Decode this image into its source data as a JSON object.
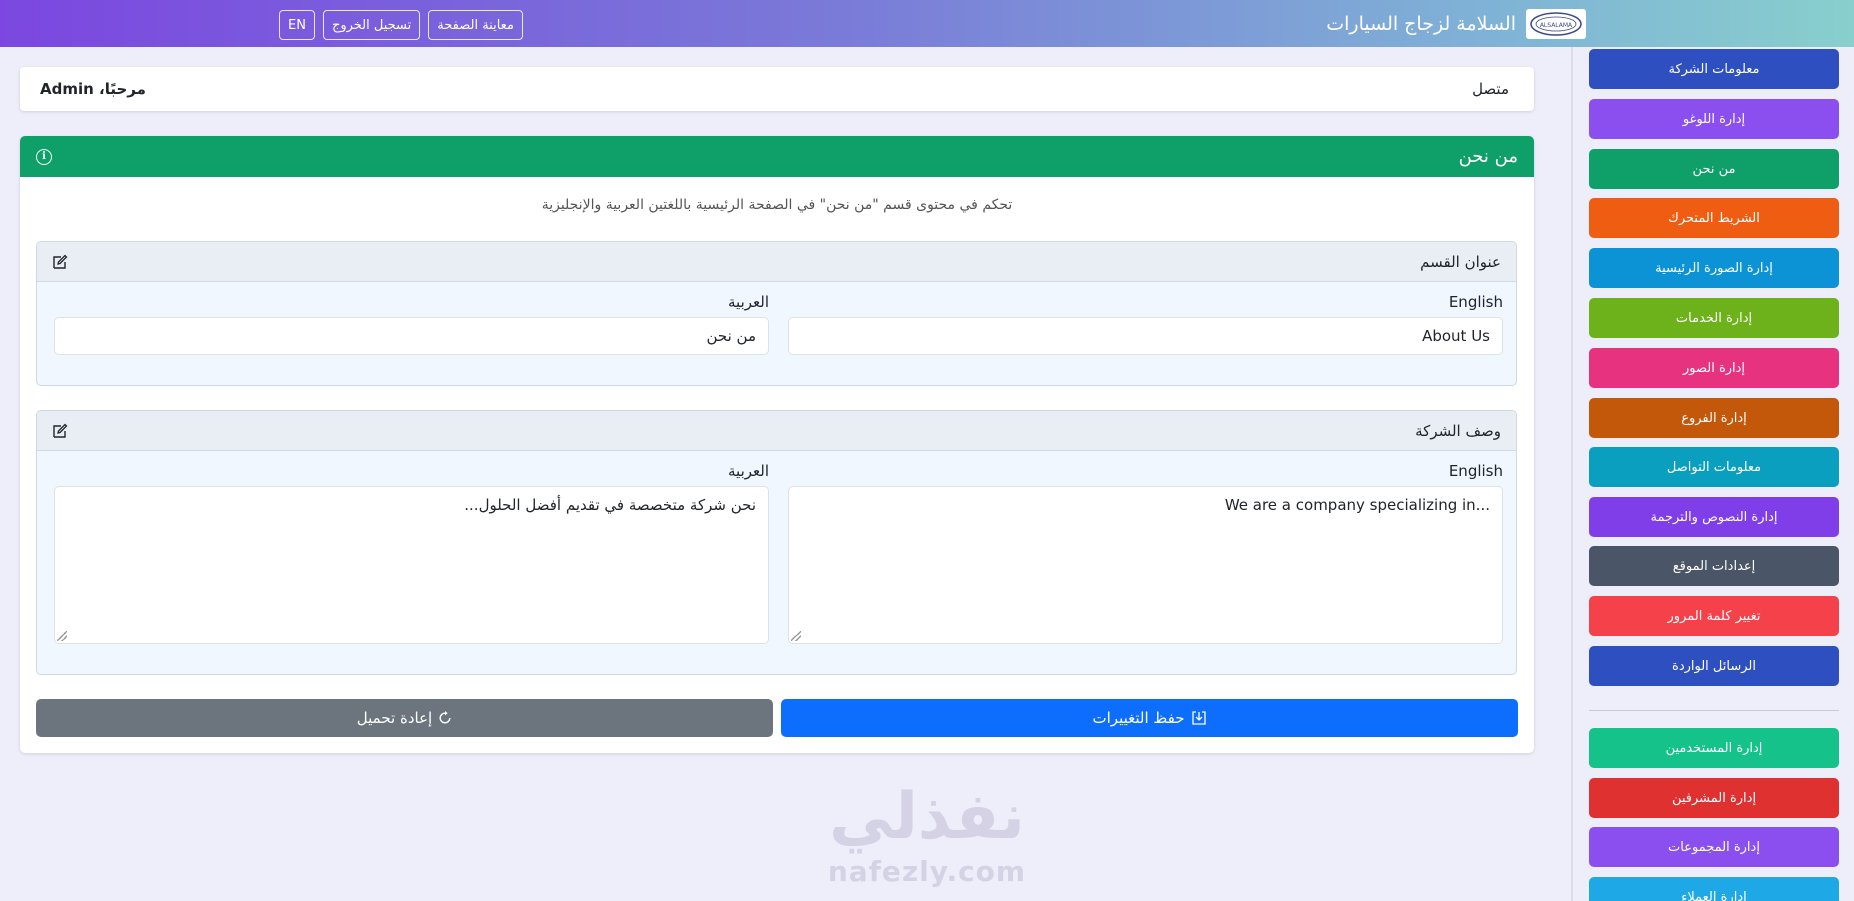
{
  "topbar": {
    "title": "السلامة لزجاج السيارات",
    "logo_text": "ALSALAMA",
    "actions": [
      {
        "label": "معاينة الصفحة"
      },
      {
        "label": "تسجيل الخروج"
      },
      {
        "label": "EN"
      }
    ]
  },
  "sidebar": {
    "items": [
      {
        "label": "معلومات الشركة",
        "color": "#2d4fbf"
      },
      {
        "label": "إدارة اللوغو",
        "color": "#8b4ff0"
      },
      {
        "label": "من نحن",
        "color": "#0fa06a"
      },
      {
        "label": "الشريط المتحرك",
        "color": "#ee5d12"
      },
      {
        "label": "إدارة الصورة الرئيسية",
        "color": "#0c93d6"
      },
      {
        "label": "إدارة الخدمات",
        "color": "#6db21a"
      },
      {
        "label": "إدارة الصور",
        "color": "#e6327f"
      },
      {
        "label": "إدارة الفروع",
        "color": "#c3570a"
      },
      {
        "label": "معلومات التواصل",
        "color": "#0b9fbf"
      },
      {
        "label": "إدارة النصوص والترجمة",
        "color": "#7f3ee8"
      },
      {
        "label": "إعدادات الموقع",
        "color": "#4a5568"
      },
      {
        "label": "تغيير كلمة المرور",
        "color": "#f5424a"
      },
      {
        "label": "الرسائل الواردة",
        "color": "#2d4fbf"
      },
      {
        "label": "إدارة المستخدمين",
        "color": "#14c28a"
      },
      {
        "label": "إدارة المشرفين",
        "color": "#e03131"
      },
      {
        "label": "إدارة المجموعات",
        "color": "#8b4ff0"
      },
      {
        "label": "إدارة العملاء",
        "color": "#1fa8e6"
      }
    ]
  },
  "header": {
    "status": "متصل",
    "welcome": "مرحبًا، Admin"
  },
  "panel": {
    "title": "من نحن",
    "description": "تحكم في محتوى قسم \"من نحن\" في الصفحة الرئيسية باللغتين العربية والإنجليزية",
    "sections": [
      {
        "title": "عنوان القسم",
        "english_label": "English",
        "arabic_label": "العربية",
        "english_value": "About Us",
        "arabic_value": "من نحن"
      },
      {
        "title": "وصف الشركة",
        "english_label": "English",
        "arabic_label": "العربية",
        "english_value": "We are a company specializing in...",
        "arabic_value": "نحن شركة متخصصة في تقديم أفضل الحلول..."
      }
    ],
    "save_label": "حفظ التغييرات",
    "reload_label": "إعادة تحميل"
  },
  "watermark": {
    "arabic": "نفذلي",
    "english": "nafezly.com"
  },
  "colors": {
    "success": "#0fa06a",
    "primary": "#0d6efd",
    "secondary": "#6c757d"
  },
  "icons": [
    "info-icon",
    "edit-icon",
    "save-icon",
    "reload-icon",
    "logo-icon"
  ]
}
